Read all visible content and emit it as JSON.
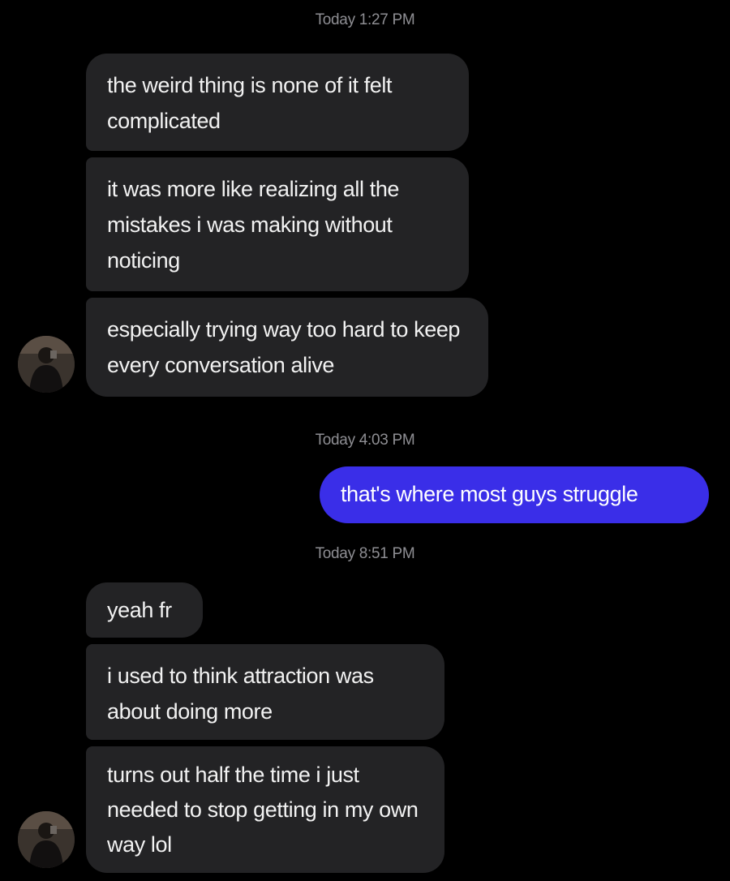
{
  "colors": {
    "background": "#000000",
    "incoming_bubble": "#232325",
    "outgoing_bubble": "#3a2ee8",
    "timestamp": "#8e8e93"
  },
  "timestamps": [
    "Today 1:27 PM",
    "Today 4:03 PM",
    "Today 8:51 PM"
  ],
  "messages": [
    {
      "direction": "incoming",
      "text": "the weird thing is none of it felt complicated"
    },
    {
      "direction": "incoming",
      "text": "it was more like realizing all the mistakes i was making without noticing"
    },
    {
      "direction": "incoming",
      "text": "especially trying way too hard to keep every conversation alive"
    },
    {
      "direction": "outgoing",
      "text": "that's where most guys struggle"
    },
    {
      "direction": "incoming",
      "text": "yeah fr"
    },
    {
      "direction": "incoming",
      "text": "i used to think attraction was about doing more"
    },
    {
      "direction": "incoming",
      "text": "turns out half the time i just needed to stop getting in my own way lol"
    }
  ],
  "avatar": {
    "icon": "contact-avatar-photo"
  }
}
